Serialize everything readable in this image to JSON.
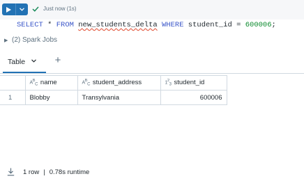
{
  "toolbar": {
    "run_icon": "play-icon",
    "menu_icon": "chevron-down-icon",
    "status_icon": "check-icon",
    "status_text": "Just now (1s)"
  },
  "code": {
    "select": "SELECT",
    "star": " * ",
    "from": "FROM",
    "table": "new_students_delta",
    "where": "WHERE",
    "condition": " student_id = ",
    "value": "600006",
    "terminator": ";"
  },
  "spark_jobs": {
    "label": "(2) Spark Jobs"
  },
  "tabs": [
    {
      "label": "Table",
      "active": true
    }
  ],
  "add_tab_icon": "plus-icon",
  "table": {
    "columns": [
      {
        "label": "name",
        "type_badge": "ABC"
      },
      {
        "label": "student_address",
        "type_badge": "ABC"
      },
      {
        "label": "student_id",
        "type_badge": "123"
      }
    ],
    "rows": [
      {
        "index": "1",
        "name": "Blobby",
        "student_address": "Transylvania",
        "student_id": "600006"
      }
    ]
  },
  "footer": {
    "download_icon": "download-icon",
    "row_count": "1 row",
    "separator": "|",
    "runtime": "0.78s runtime"
  },
  "colors": {
    "accent": "#2272b4",
    "success": "#1a8c5b",
    "keyword": "#3a56c9",
    "number": "#0b8a2d"
  }
}
